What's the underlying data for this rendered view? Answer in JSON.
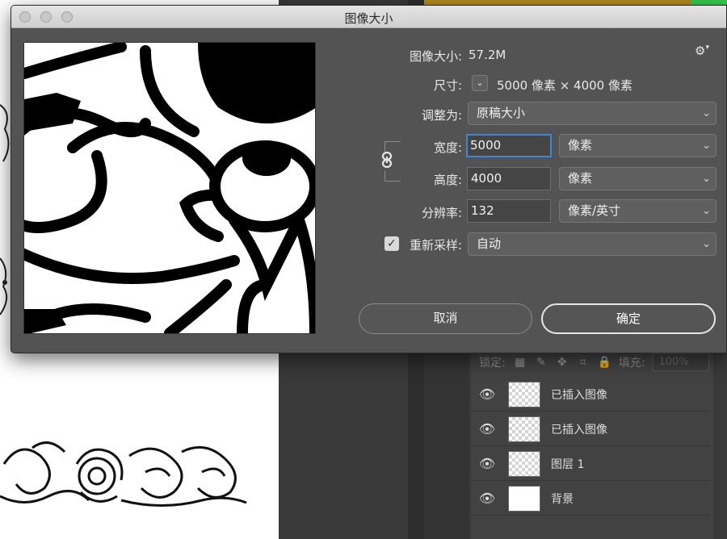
{
  "dialog": {
    "title": "图像大小",
    "image_size_label": "图像大小:",
    "image_size_value": "57.2M",
    "dimensions_label": "尺寸:",
    "dimensions_value": "5000 像素  ×  4000 像素",
    "fit_to_label": "调整为:",
    "fit_to_value": "原稿大小",
    "width_label": "宽度:",
    "width_value": "5000",
    "width_unit": "像素",
    "height_label": "高度:",
    "height_value": "4000",
    "height_unit": "像素",
    "resolution_label": "分辨率:",
    "resolution_value": "132",
    "resolution_unit": "像素/英寸",
    "resample_label": "重新采样:",
    "resample_value": "自动",
    "resample_checked": true,
    "cancel_label": "取消",
    "ok_label": "确定",
    "focus_color": "#3f86d6"
  },
  "layers": {
    "lock_label": "锁定:",
    "fill_label": "填充:",
    "fill_value": "100%",
    "items": [
      {
        "name": "已插入图像",
        "visible": true,
        "thumb": "transparent"
      },
      {
        "name": "已插入图像",
        "visible": true,
        "thumb": "transparent"
      },
      {
        "name": "图层 1",
        "visible": true,
        "thumb": "transparent"
      },
      {
        "name": "背景",
        "visible": true,
        "thumb": "white"
      }
    ]
  },
  "icons": {
    "eye": "👁",
    "gear": "⚙",
    "chevron": "⌄",
    "link": "🔗",
    "check": "✓"
  },
  "colors": {
    "dialog_bg": "#535353",
    "panel_bg": "#393939",
    "accent_gold": "#b48a1c",
    "accent_green": "#35c94a"
  }
}
